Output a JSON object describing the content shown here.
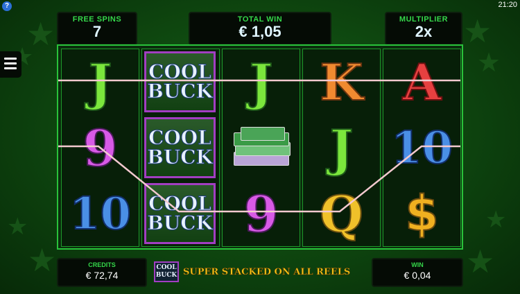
{
  "status": {
    "clock": "21:20"
  },
  "help_icon_glyph": "?",
  "header": {
    "free_spins_label": "FREE SPINS",
    "free_spins_value": "7",
    "total_win_label": "TOTAL WIN",
    "total_win_value": "€ 1,05",
    "multiplier_label": "MULTIPLIER",
    "multiplier_value": "2x"
  },
  "reels": {
    "reel1": [
      "J",
      "9",
      "10"
    ],
    "reel3_top": "J",
    "reel3_bottom": "9",
    "reel4": [
      "K",
      "J",
      "Q"
    ],
    "reel5": [
      "A",
      "10",
      "$"
    ],
    "coolbuck_word1": "COOL",
    "coolbuck_word2": "BUCK"
  },
  "footer": {
    "credits_label": "CREDITS",
    "credits_value": "€ 72,74",
    "win_label": "WIN",
    "win_value": "€ 0,04",
    "banner_text": "SUPER STACKED ON ALL REELS"
  },
  "colors": {
    "background": "#0f4a10",
    "label_green": "#35d84a",
    "reel_border": "#29c23a",
    "coolbuck_border": "#a23ec2",
    "banner_gold": "#f5c518"
  },
  "icons": [
    "help-icon",
    "menu-icon"
  ]
}
